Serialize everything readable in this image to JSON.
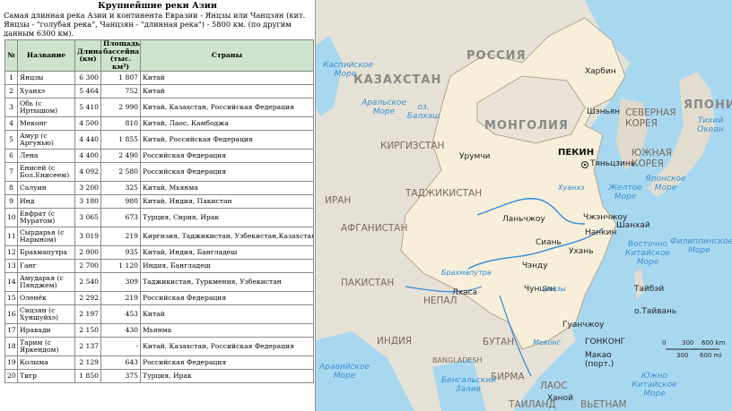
{
  "panel": {
    "title": "Крупнейшие реки Азии",
    "intro": "Самая длинная река Азии и континента Евразии - Янцзы или Чанцзян (кит. Янцзы - \"голубая река\", Чанцзян - \"длинная река\") - 5800 км. (по другим данным 6300 км).",
    "headers": [
      "№",
      "Название",
      "Длина (км)",
      "Площадь бассейна (тыс. км²)",
      "Страны"
    ],
    "rows": [
      {
        "n": "1",
        "name": "Янцзы",
        "len": "6 300",
        "area": "1 807",
        "countries": "Китай"
      },
      {
        "n": "2",
        "name": "Хуанхэ",
        "len": "5 464",
        "area": "752",
        "countries": "Китай"
      },
      {
        "n": "3",
        "name": "Обь (с Иртышом)",
        "len": "5 410",
        "area": "2 990",
        "countries": "Китай, Казахстан, Российская Федерация"
      },
      {
        "n": "4",
        "name": "Меконг",
        "len": "4 500",
        "area": "810",
        "countries": "Китай, Лаос, Камбоджа"
      },
      {
        "n": "5",
        "name": "Амур (с Аргунью)",
        "len": "4 440",
        "area": "1 855",
        "countries": "Китай, Российская Федерация"
      },
      {
        "n": "6",
        "name": "Лена",
        "len": "4 400",
        "area": "2 490",
        "countries": "Российская Федерация"
      },
      {
        "n": "7",
        "name": "Енисей (с Бол.Енисеем)",
        "len": "4 092",
        "area": "2 580",
        "countries": "Российская Федерация"
      },
      {
        "n": "8",
        "name": "Салуин",
        "len": "3 200",
        "area": "325",
        "countries": "Китай, Мьянма"
      },
      {
        "n": "9",
        "name": "Инд",
        "len": "3 180",
        "area": "980",
        "countries": "Китай, Индия, Пакистан"
      },
      {
        "n": "10",
        "name": "Евфрат (с Муратом)",
        "len": "3 065",
        "area": "673",
        "countries": "Турция, Сирия, Ирак"
      },
      {
        "n": "11",
        "name": "Сырдарья (с Нарыном)",
        "len": "3 019",
        "area": "219",
        "countries": "Киргизия, Таджикистан, Узбекистан,Казахстан"
      },
      {
        "n": "12",
        "name": "Брахмапутра",
        "len": "2 900",
        "area": "935",
        "countries": "Китай, Индия, Бангладеш"
      },
      {
        "n": "13",
        "name": "Ганг",
        "len": "2 700",
        "area": "1 120",
        "countries": "Индия, Бангладеш"
      },
      {
        "n": "14",
        "name": "Амударья (с Пянджем)",
        "len": "2 540",
        "area": "309",
        "countries": "Таджикистан, Туркмения, Узбекистан"
      },
      {
        "n": "15",
        "name": "Оленёк",
        "len": "2 292",
        "area": "219",
        "countries": "Российская Федерация"
      },
      {
        "n": "16",
        "name": "Сицзян (с Хуншуйхэ)",
        "len": "2 197",
        "area": "453",
        "countries": "Китай"
      },
      {
        "n": "17",
        "name": "Иравади",
        "len": "2 150",
        "area": "430",
        "countries": "Мьянма"
      },
      {
        "n": "18",
        "name": "Тарим (с Яркендом)",
        "len": "2 137",
        "area": "-",
        "countries": "Китай, Казахстан, Российская Федерация"
      },
      {
        "n": "19",
        "name": "Колыма",
        "len": "2 129",
        "area": "643",
        "countries": "Российская Федерация"
      },
      {
        "n": "20",
        "name": "Тигр",
        "len": "1 850",
        "area": "375",
        "countries": "Турция, Ирак"
      }
    ]
  },
  "map": {
    "countries": {
      "russia": "РОССИЯ",
      "kazakhstan": "КАЗАХСТАН",
      "mongolia": "МОНГОЛИЯ",
      "kyrgyzstan": "КИРГИЗСТАН",
      "tajikistan": "ТАДЖИКИСТАН",
      "afghanistan": "АФГАНИСТАН",
      "iran": "ИРАН",
      "pakistan": "ПАКИСТАН",
      "india": "ИНДИЯ",
      "nepal": "НЕПАЛ",
      "bhutan": "БУТАН",
      "bangladesh": "BANGLADESH",
      "burma": "БИРМА",
      "laos": "ЛАОС",
      "thailand": "ТАИЛАНД",
      "vietnam": "ВЬЕТНАМ",
      "north_korea": "СЕВЕРНАЯ КОРЕЯ",
      "south_korea": "ЮЖНАЯ КОРЕЯ",
      "japan": "ЯПОНИЯ"
    },
    "seas": {
      "caspian": "Каспийское Море",
      "aral": "Аральское Море",
      "balkhash": "оз. Балхаш",
      "pacific": "Тихий Океан",
      "sea_of_japan": "Японское Море",
      "yellow_sea": "Желтое Море",
      "east_china_sea": "Восточно Китайское Море",
      "philippine_sea": "Филиппинское Море",
      "arabian_sea": "Аравийское Море",
      "bay_of_bengal": "Бенгальский Залив",
      "south_china_sea": "Южно Китайское Море"
    },
    "cities": {
      "harbin": "Харбин",
      "shenyang": "Шэньян",
      "beijing": "ПЕКИН",
      "tianjin": "Тяньцзинь",
      "urumqi": "Урумчи",
      "lanzhou": "Ланьчжоу",
      "zhengzhou": "Чжэнчжоу",
      "nanjing": "Нанкин",
      "shanghai": "Шанхай",
      "xian": "Сиань",
      "wuhan": "Ухань",
      "chengdu": "Чэнду",
      "chongqing": "Чунцин",
      "lhasa": "Лхаса",
      "guangzhou": "Гуанчжоу",
      "hongkong": "ГОНКОНГ",
      "macau": "Макао (порт.)",
      "taipei": "Тайбэй",
      "taiwan": "о.Тайвань",
      "hanoi": "Ханой"
    },
    "rivers": {
      "yellow": "Хуанхэ",
      "yangtze": "Янцзы",
      "brahmaputra": "Брахмапутра",
      "mekong": "Меконг"
    },
    "scale": {
      "t0": "0",
      "t1": "300",
      "t2": "600 km",
      "b1": "300",
      "b2": "600 mi"
    }
  }
}
